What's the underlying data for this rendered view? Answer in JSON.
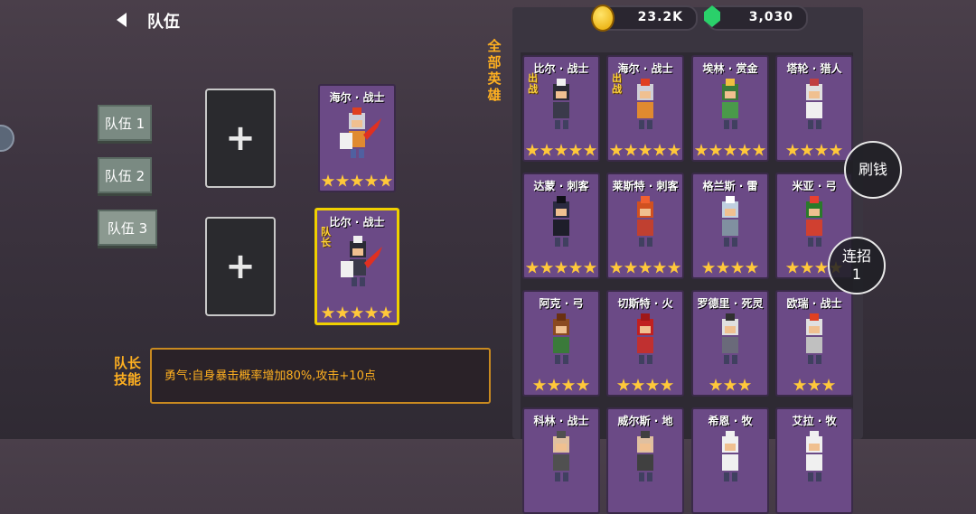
{
  "header": {
    "title": "队伍"
  },
  "teams": [
    "队伍 1",
    "队伍 2",
    "队伍 3"
  ],
  "slots": {
    "add_symbol": "+"
  },
  "team_cards": [
    {
      "name": "海尔 · 战士",
      "tag": "",
      "stars": 5
    },
    {
      "name": "比尔 · 战士",
      "tag": "队长",
      "stars": 5
    }
  ],
  "currency": {
    "coins": "23.2K",
    "gems": "3,030"
  },
  "all_heroes_label": "全部英雄",
  "heroes": [
    {
      "name": "比尔 · 战士",
      "tag": "出战",
      "stars": 5
    },
    {
      "name": "海尔 · 战士",
      "tag": "出战",
      "stars": 5
    },
    {
      "name": "埃林 · 赏金",
      "tag": "",
      "stars": 5
    },
    {
      "name": "塔轮 · 猎人",
      "tag": "",
      "stars": 4
    },
    {
      "name": "达蒙 · 刺客",
      "tag": "",
      "stars": 5
    },
    {
      "name": "莱斯特 · 刺客",
      "tag": "",
      "stars": 5
    },
    {
      "name": "格兰斯 · 雷",
      "tag": "",
      "stars": 4
    },
    {
      "name": "米亚 · 弓",
      "tag": "",
      "stars": 4
    },
    {
      "name": "阿克 · 弓",
      "tag": "",
      "stars": 4
    },
    {
      "name": "切斯特 · 火",
      "tag": "",
      "stars": 4
    },
    {
      "name": "罗德里 · 死灵",
      "tag": "",
      "stars": 3
    },
    {
      "name": "欧瑞 · 战士",
      "tag": "",
      "stars": 3
    },
    {
      "name": "科林 · 战士",
      "tag": "",
      "stars": 0
    },
    {
      "name": "威尔斯 · 地",
      "tag": "",
      "stars": 0
    },
    {
      "name": "希恩 · 牧",
      "tag": "",
      "stars": 0
    },
    {
      "name": "艾拉 · 牧",
      "tag": "",
      "stars": 0
    }
  ],
  "buttons": {
    "money": "刷钱",
    "combo_line1": "连招",
    "combo_line2": "1"
  },
  "leader_skill": {
    "label_line1": "队长",
    "label_line2": "技能",
    "text": "勇气:自身暴击概率增加80%,攻击+10点"
  }
}
